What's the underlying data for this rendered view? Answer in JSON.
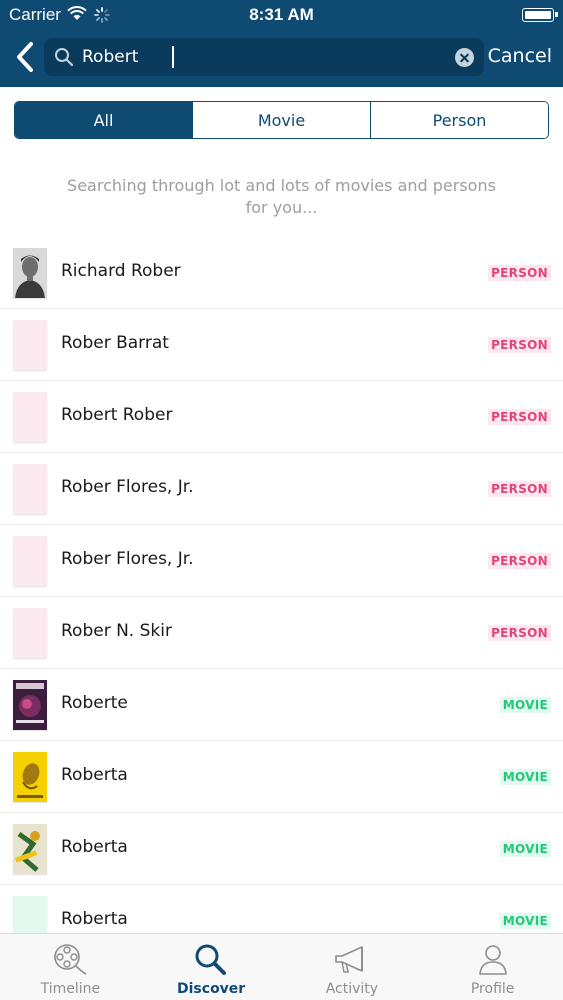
{
  "status_bar": {
    "carrier": "Carrier",
    "time": "8:31 AM"
  },
  "search": {
    "value": "Robert",
    "cancel_label": "Cancel"
  },
  "segments": [
    {
      "label": "All",
      "active": true
    },
    {
      "label": "Movie",
      "active": false
    },
    {
      "label": "Person",
      "active": false
    }
  ],
  "message": "Searching through lot and lots of movies and persons for you...",
  "results": [
    {
      "title": "Richard Rober",
      "type": "PERSON"
    },
    {
      "title": "Rober Barrat",
      "type": "PERSON"
    },
    {
      "title": "Robert Rober",
      "type": "PERSON"
    },
    {
      "title": "Rober Flores, Jr.",
      "type": "PERSON"
    },
    {
      "title": "Rober Flores, Jr.",
      "type": "PERSON"
    },
    {
      "title": "Rober N. Skir",
      "type": "PERSON"
    },
    {
      "title": "Roberte",
      "type": "MOVIE"
    },
    {
      "title": "Roberta",
      "type": "MOVIE"
    },
    {
      "title": "Roberta",
      "type": "MOVIE"
    },
    {
      "title": "Roberta",
      "type": "MOVIE"
    }
  ],
  "tabs": [
    {
      "label": "Timeline",
      "icon": "film-reel-icon",
      "active": false
    },
    {
      "label": "Discover",
      "icon": "search-icon",
      "active": true
    },
    {
      "label": "Activity",
      "icon": "megaphone-icon",
      "active": false
    },
    {
      "label": "Profile",
      "icon": "person-icon",
      "active": false
    }
  ],
  "colors": {
    "primary": "#0f4a73",
    "person_badge": "#e0457b",
    "movie_badge": "#21c77a"
  }
}
